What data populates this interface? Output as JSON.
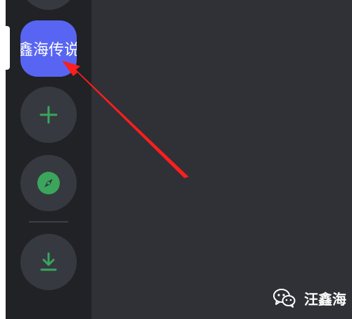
{
  "sidebar": {
    "selected_server": {
      "label": "鑫海传说",
      "color": "#5865f2"
    },
    "add_server": {
      "icon": "plus-icon",
      "color": "#3ba55c"
    },
    "explore": {
      "icon": "compass-icon",
      "color": "#3ba55c"
    },
    "download": {
      "icon": "download-icon",
      "color": "#3ba55c"
    }
  },
  "watermark": {
    "text": "汪鑫海"
  }
}
